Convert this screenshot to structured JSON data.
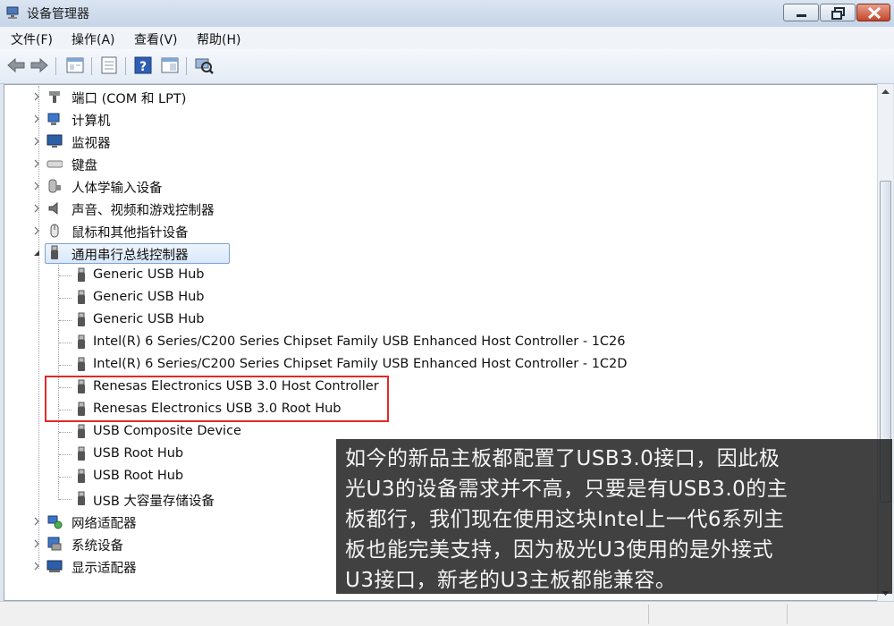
{
  "window": {
    "title": "设备管理器"
  },
  "menu": [
    "文件(F)",
    "操作(A)",
    "查看(V)",
    "帮助(H)"
  ],
  "toolbar_icons": [
    "back-arrow-icon",
    "forward-arrow-icon",
    "properties-icon",
    "console-tree-icon",
    "help-icon",
    "action-pane-icon",
    "scan-hardware-icon"
  ],
  "tree": {
    "categories_top": [
      {
        "label": "端口 (COM 和 LPT)",
        "icon": "port-icon"
      },
      {
        "label": "计算机",
        "icon": "computer-icon"
      },
      {
        "label": "监视器",
        "icon": "monitor-icon"
      },
      {
        "label": "键盘",
        "icon": "keyboard-icon"
      },
      {
        "label": "人体学输入设备",
        "icon": "hid-icon"
      },
      {
        "label": "声音、视频和游戏控制器",
        "icon": "speaker-icon"
      },
      {
        "label": "鼠标和其他指针设备",
        "icon": "mouse-icon"
      }
    ],
    "usb_category": {
      "label": "通用串行总线控制器",
      "icon": "usb-plug-icon"
    },
    "usb_devices": [
      "Generic USB Hub",
      "Generic USB Hub",
      "Generic USB Hub",
      "Intel(R) 6 Series/C200 Series Chipset Family USB Enhanced Host Controller - 1C26",
      "Intel(R) 6 Series/C200 Series Chipset Family USB Enhanced Host Controller - 1C2D",
      "Renesas Electronics USB 3.0 Host Controller",
      "Renesas Electronics USB 3.0 Root Hub",
      "USB Composite Device",
      "USB Root Hub",
      "USB Root Hub",
      "USB 大容量存储设备"
    ],
    "categories_bottom": [
      {
        "label": "网络适配器",
        "icon": "network-icon"
      },
      {
        "label": "系统设备",
        "icon": "system-device-icon"
      },
      {
        "label": "显示适配器",
        "icon": "display-adapter-icon"
      }
    ]
  },
  "caption": {
    "lines": [
      "如今的新品主板都配置了USB3.0接口，因此极",
      "光U3的设备需求并不高，只要是有USB3.0的主",
      "板都行，我们现在使用这块Intel上一代6系列主",
      "板也能完美支持，因为极光U3使用的是外接式",
      "U3接口，新老的U3主板都能兼容。"
    ]
  },
  "colors": {
    "highlight_box": "#e02a2a",
    "selection": "#d8e8fa",
    "caption_bg": "#222222"
  }
}
